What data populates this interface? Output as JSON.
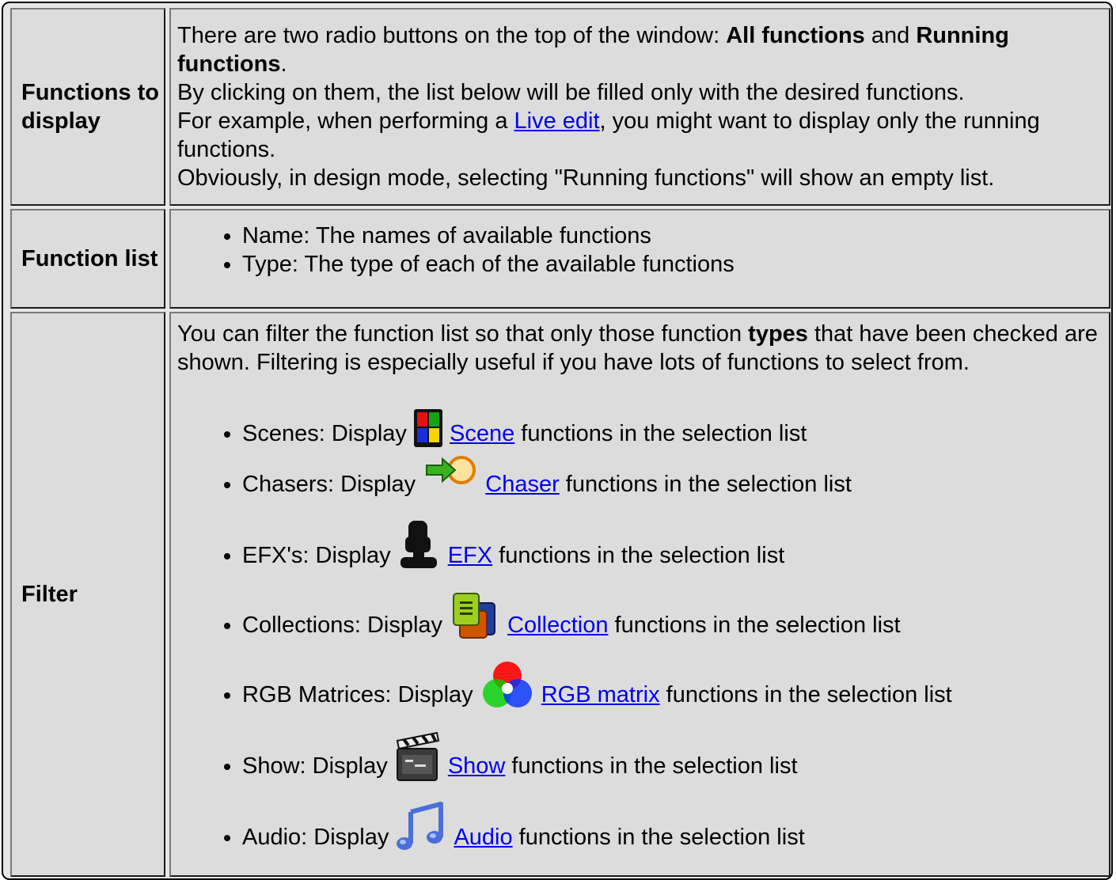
{
  "rows": {
    "functions_to_display": {
      "label": "Functions to display",
      "intro_pre": "There are two radio buttons on the top of the window: ",
      "all_functions": "All functions",
      "and": " and ",
      "running_functions": "Running functions",
      "period": ".",
      "line2": "By clicking on them, the list below will be filled only with the desired functions.",
      "line3_pre": "For example, when performing a ",
      "live_edit_link": "Live edit",
      "line3_post": ", you might want to display only the running functions.",
      "line4": "Obviously, in design mode, selecting \"Running functions\" will show an empty list."
    },
    "function_list": {
      "label": "Function list",
      "items": [
        "Name: The names of available functions",
        "Type: The type of each of the available functions"
      ]
    },
    "filter": {
      "label": "Filter",
      "intro_pre": "You can filter the function list so that only those function ",
      "types": "types",
      "intro_post": " that have been checked are shown. Filtering is especially useful if you have lots of functions to select from.",
      "items": [
        {
          "prefix": "Scenes: Display ",
          "link": "Scene",
          "suffix": " functions in the selection list",
          "icon": "scene-icon"
        },
        {
          "prefix": "Chasers: Display ",
          "link": "Chaser",
          "suffix": " functions in the selection list",
          "icon": "chaser-icon"
        },
        {
          "prefix": "EFX's: Display ",
          "link": "EFX",
          "suffix": " functions in the selection list",
          "icon": "efx-icon"
        },
        {
          "prefix": "Collections: Display ",
          "link": "Collection",
          "suffix": " functions in the selection list",
          "icon": "collection-icon"
        },
        {
          "prefix": "RGB Matrices: Display ",
          "link": "RGB matrix",
          "suffix": " functions in the selection list",
          "icon": "rgb-matrix-icon"
        },
        {
          "prefix": "Show: Display ",
          "link": "Show",
          "suffix": " functions in the selection list",
          "icon": "show-icon"
        },
        {
          "prefix": "Audio: Display ",
          "link": "Audio",
          "suffix": " functions in the selection list",
          "icon": "audio-icon"
        }
      ]
    }
  },
  "colors": {
    "link": "#0000ee",
    "cell_bg": "#dcdcdc"
  }
}
